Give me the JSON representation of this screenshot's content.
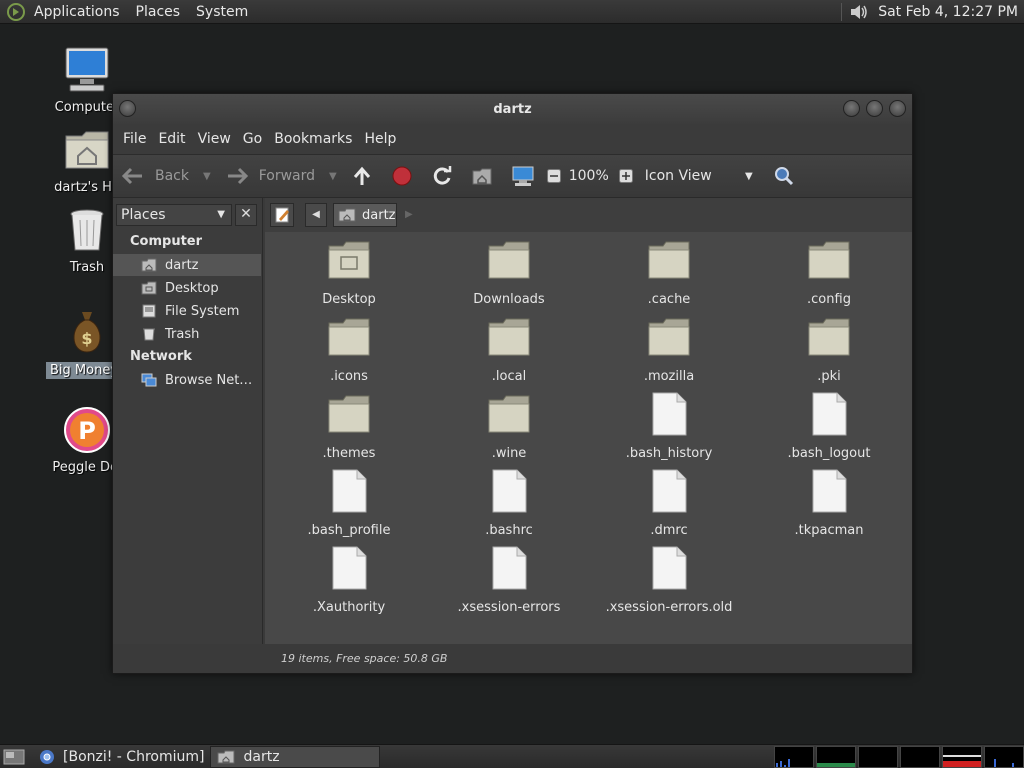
{
  "top_panel": {
    "menus": [
      "Applications",
      "Places",
      "System"
    ],
    "clock": "Sat Feb  4, 12:27 PM"
  },
  "desktop_icons": [
    {
      "label": "Computer",
      "icon": "computer-icon"
    },
    {
      "label": "dartz's Ho",
      "icon": "home-folder-icon"
    },
    {
      "label": "Trash",
      "icon": "trash-icon"
    },
    {
      "label": "Big Money D",
      "icon": "money-bag-icon",
      "selected": true
    },
    {
      "label": "Peggle Del",
      "icon": "peggle-icon"
    }
  ],
  "window": {
    "title": "dartz",
    "menubar": [
      "File",
      "Edit",
      "View",
      "Go",
      "Bookmarks",
      "Help"
    ],
    "toolbar": {
      "back": "Back",
      "forward": "Forward",
      "zoom": "100%",
      "view_mode": "Icon View"
    },
    "sidebar": {
      "combo": "Places",
      "computer_header": "Computer",
      "network_header": "Network",
      "items": [
        {
          "label": "dartz",
          "icon": "home-icon",
          "selected": true
        },
        {
          "label": "Desktop",
          "icon": "desktop-icon"
        },
        {
          "label": "File System",
          "icon": "drive-icon"
        },
        {
          "label": "Trash",
          "icon": "trash-icon"
        }
      ],
      "network_items": [
        {
          "label": "Browse Net…",
          "icon": "network-icon"
        }
      ]
    },
    "pathbar": {
      "crumb": "dartz"
    },
    "files": [
      {
        "name": "Desktop",
        "type": "folder",
        "desktop": true
      },
      {
        "name": "Downloads",
        "type": "folder"
      },
      {
        "name": ".cache",
        "type": "folder"
      },
      {
        "name": ".config",
        "type": "folder"
      },
      {
        "name": ".icons",
        "type": "folder"
      },
      {
        "name": ".local",
        "type": "folder"
      },
      {
        "name": ".mozilla",
        "type": "folder"
      },
      {
        "name": ".pki",
        "type": "folder"
      },
      {
        "name": ".themes",
        "type": "folder"
      },
      {
        "name": ".wine",
        "type": "folder"
      },
      {
        "name": ".bash_history",
        "type": "file"
      },
      {
        "name": ".bash_logout",
        "type": "file"
      },
      {
        "name": ".bash_profile",
        "type": "file"
      },
      {
        "name": ".bashrc",
        "type": "file"
      },
      {
        "name": ".dmrc",
        "type": "file"
      },
      {
        "name": ".tkpacman",
        "type": "file"
      },
      {
        "name": ".Xauthority",
        "type": "file"
      },
      {
        "name": ".xsession-errors",
        "type": "file"
      },
      {
        "name": ".xsession-errors.old",
        "type": "file"
      }
    ],
    "status": "19 items, Free space: 50.8 GB"
  },
  "taskbar": {
    "tasks": [
      {
        "label": "[Bonzi! - Chromium]",
        "icon": "chromium-icon"
      },
      {
        "label": "dartz",
        "icon": "home-folder-icon",
        "active": true
      }
    ]
  }
}
